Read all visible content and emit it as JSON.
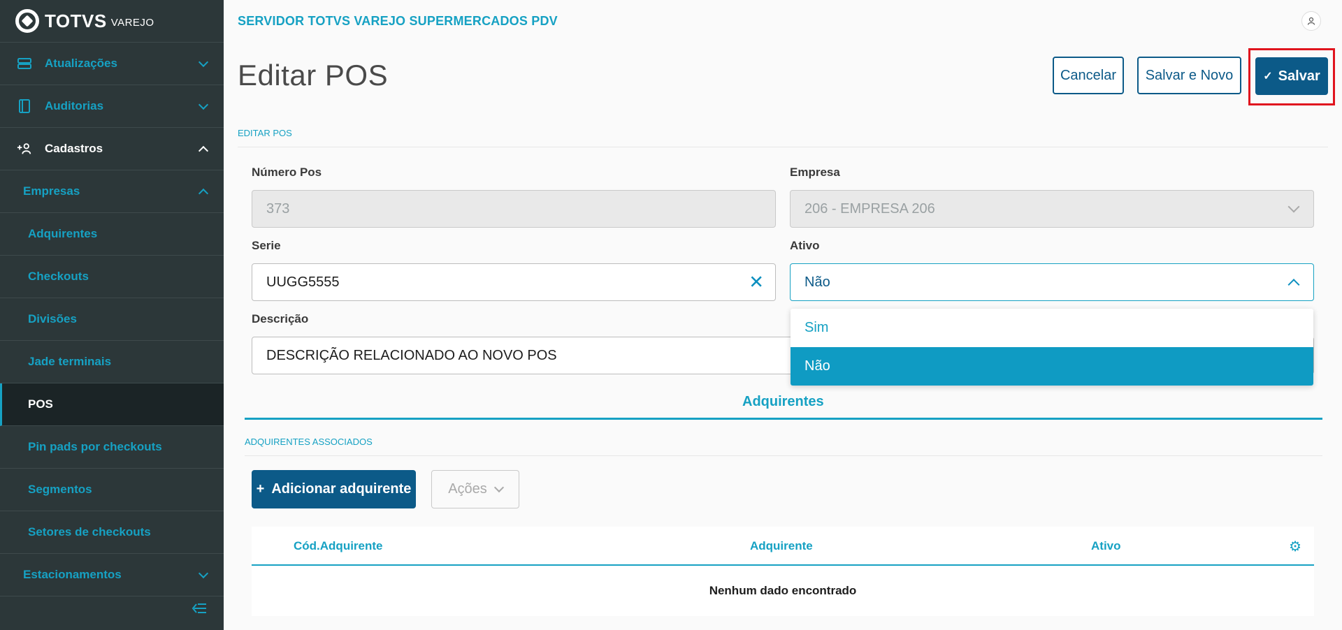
{
  "brand": {
    "name": "TOTVS",
    "sub": "VAREJO"
  },
  "sidebar": {
    "items": [
      {
        "label": "Atualizações"
      },
      {
        "label": "Auditorias"
      },
      {
        "label": "Cadastros"
      },
      {
        "label": "Empresas"
      },
      {
        "label": "Adquirentes"
      },
      {
        "label": "Checkouts"
      },
      {
        "label": "Divisões"
      },
      {
        "label": "Jade terminais"
      },
      {
        "label": "POS"
      },
      {
        "label": "Pin pads por checkouts"
      },
      {
        "label": "Segmentos"
      },
      {
        "label": "Setores de checkouts"
      },
      {
        "label": "Estacionamentos"
      }
    ]
  },
  "header": {
    "server_title": "SERVIDOR TOTVS VAREJO SUPERMERCADOS PDV"
  },
  "page": {
    "title": "Editar POS",
    "section": "EDITAR POS"
  },
  "actions": {
    "cancel": "Cancelar",
    "save_new": "Salvar e Novo",
    "save": "Salvar"
  },
  "form": {
    "numero_label": "Número Pos",
    "numero_value": "373",
    "empresa_label": "Empresa",
    "empresa_value": "206 - EMPRESA 206",
    "serie_label": "Serie",
    "serie_value": "UUGG5555",
    "ativo_label": "Ativo",
    "ativo_value": "Não",
    "descricao_label": "Descrição",
    "descricao_value": "DESCRIÇÃO RELACIONADO AO NOVO POS",
    "ativo_options": [
      "Sim",
      "Não"
    ]
  },
  "tabs": {
    "active": "Adquirentes"
  },
  "adquirentes": {
    "section": "ADQUIRENTES ASSOCIADOS",
    "add_button": "Adicionar adquirente",
    "actions_button": "Ações",
    "columns": [
      "Cód.Adquirente",
      "Adquirente",
      "Ativo"
    ],
    "empty": "Nenhum dado encontrado"
  },
  "colors": {
    "sidebar_bg": "#2c3739",
    "accent": "#16a1c3",
    "primary": "#0c5a88",
    "highlight": "#e0141e"
  }
}
